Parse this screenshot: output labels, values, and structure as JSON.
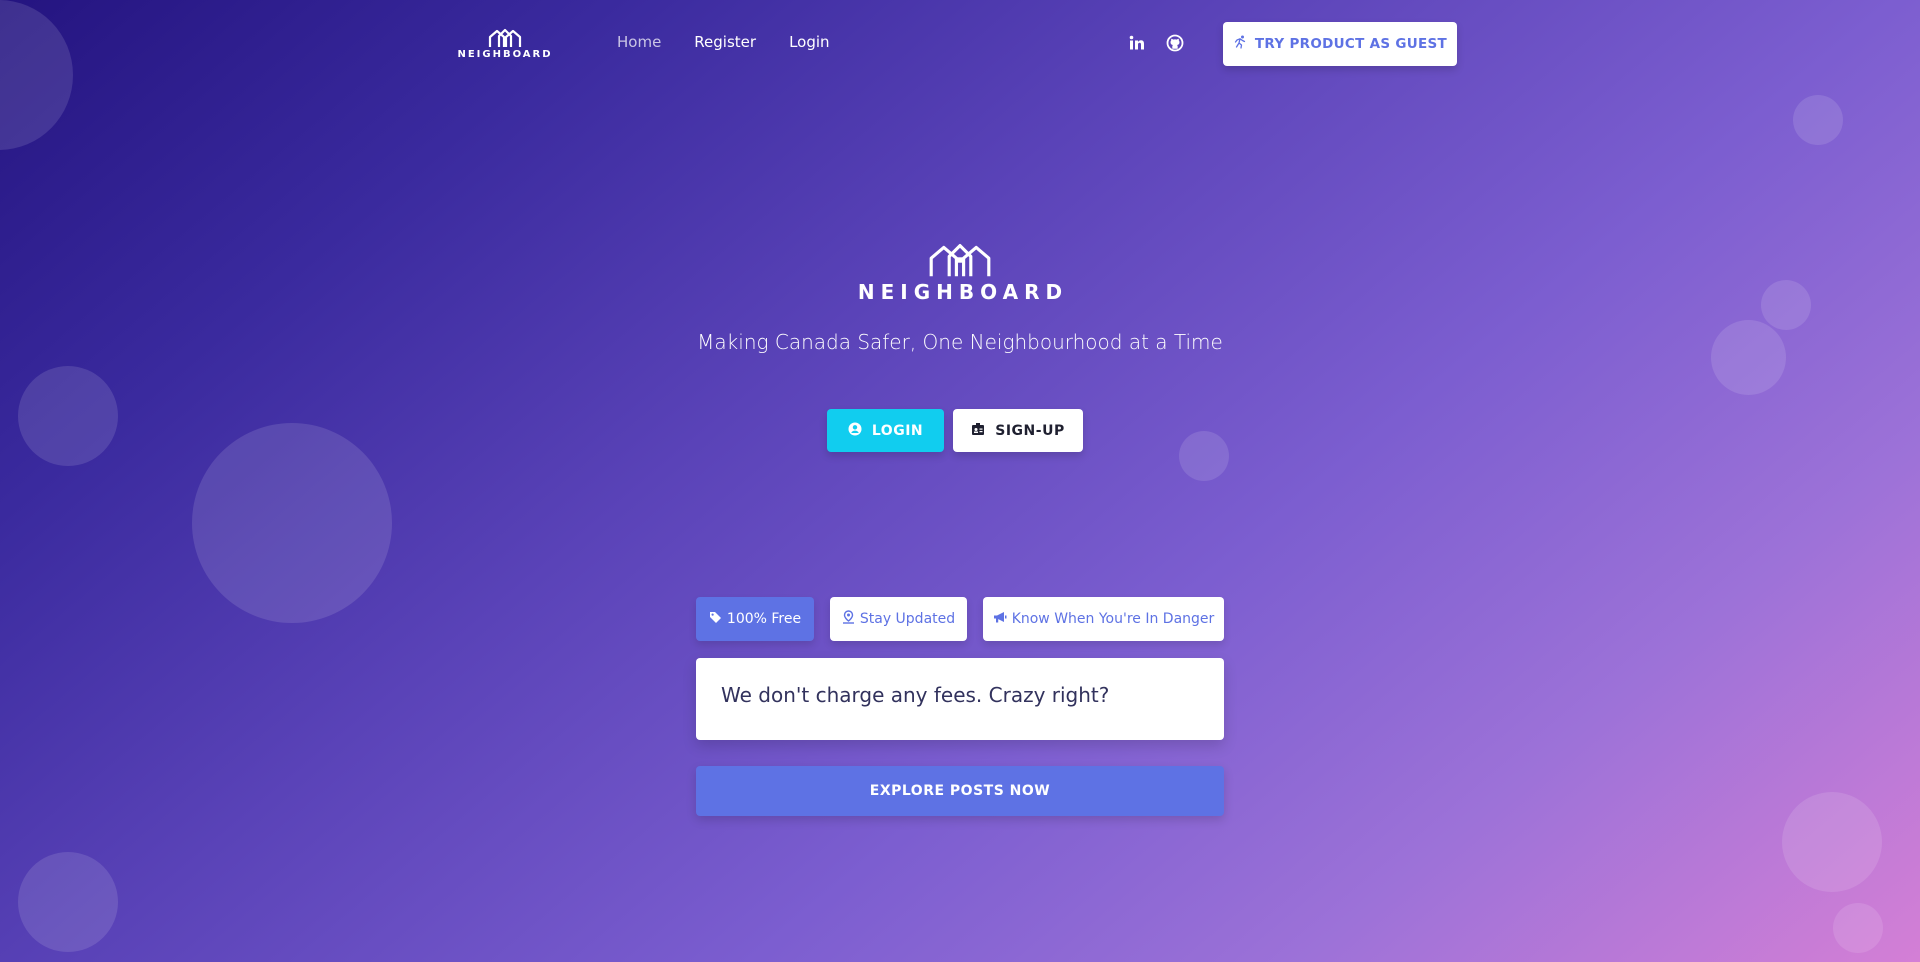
{
  "brand": {
    "name": "NEIGHBOARD"
  },
  "nav": {
    "links": [
      {
        "label": "Home",
        "active": true
      },
      {
        "label": "Register",
        "active": false
      },
      {
        "label": "Login",
        "active": false
      }
    ],
    "social_icons": [
      "linkedin-icon",
      "github-icon"
    ],
    "guest_button": {
      "label": "TRY PRODUCT AS GUEST",
      "icon": "running-person-icon"
    }
  },
  "hero": {
    "logo_text": "NEIGHBOARD",
    "tagline": "Making Canada Safer, One Neighbourhood at a Time",
    "login_button": {
      "label": "LOGIN",
      "icon": "user-circle-icon"
    },
    "signup_button": {
      "label": "SIGN-UP",
      "icon": "id-card-icon"
    }
  },
  "features": {
    "tabs": [
      {
        "label": "100% Free",
        "icon": "tag-icon",
        "active": true
      },
      {
        "label": "Stay Updated",
        "icon": "map-pin-icon",
        "active": false
      },
      {
        "label": "Know When You're In Danger",
        "icon": "megaphone-icon",
        "active": false
      }
    ],
    "active_panel_text": "We don't charge any fees. Crazy right?",
    "explore_button": "EXPLORE POSTS NOW"
  },
  "colors": {
    "primary": "#5e72e4",
    "info": "#11cdef",
    "gradient_start": "#241480",
    "gradient_end": "#d47fd6"
  }
}
